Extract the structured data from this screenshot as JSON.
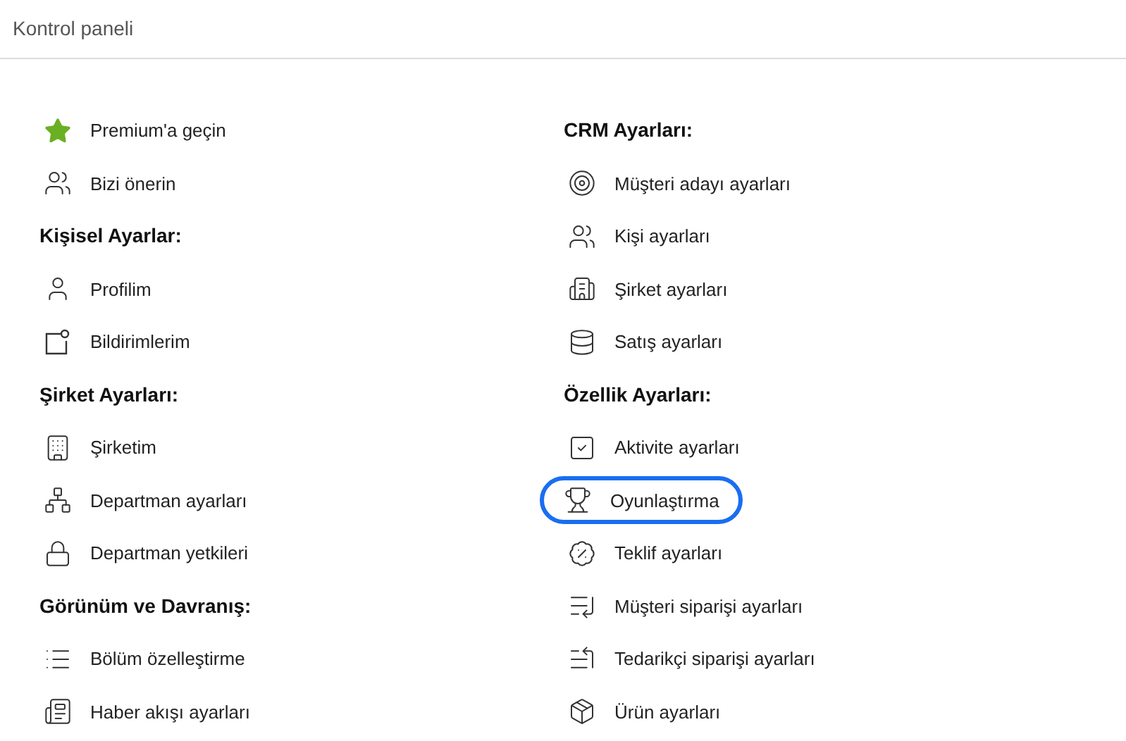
{
  "header": {
    "title": "Kontrol paneli"
  },
  "columns": [
    {
      "items": [
        {
          "kind": "link",
          "label": "Premium'a geçin",
          "highlighted": false
        },
        {
          "kind": "link",
          "label": "Bizi önerin",
          "highlighted": false
        },
        {
          "kind": "heading",
          "label": "Kişisel Ayarlar:"
        },
        {
          "kind": "link",
          "label": "Profilim",
          "highlighted": false
        },
        {
          "kind": "link",
          "label": "Bildirimlerim",
          "highlighted": false
        },
        {
          "kind": "heading",
          "label": "Şirket Ayarları:"
        },
        {
          "kind": "link",
          "label": "Şirketim",
          "highlighted": false
        },
        {
          "kind": "link",
          "label": "Departman ayarları",
          "highlighted": false
        },
        {
          "kind": "link",
          "label": "Departman yetkileri",
          "highlighted": false
        },
        {
          "kind": "heading",
          "label": "Görünüm ve Davranış:"
        },
        {
          "kind": "link",
          "label": "Bölüm özelleştirme",
          "highlighted": false
        },
        {
          "kind": "link",
          "label": "Haber akışı ayarları",
          "highlighted": false
        }
      ]
    },
    {
      "items": [
        {
          "kind": "heading",
          "label": "CRM Ayarları:"
        },
        {
          "kind": "link",
          "label": "Müşteri adayı ayarları",
          "highlighted": false
        },
        {
          "kind": "link",
          "label": "Kişi ayarları",
          "highlighted": false
        },
        {
          "kind": "link",
          "label": "Şirket ayarları",
          "highlighted": false
        },
        {
          "kind": "link",
          "label": "Satış ayarları",
          "highlighted": false
        },
        {
          "kind": "heading",
          "label": "Özellik Ayarları:"
        },
        {
          "kind": "link",
          "label": "Aktivite ayarları",
          "highlighted": false
        },
        {
          "kind": "link",
          "label": "Oyunlaştırma",
          "highlighted": true
        },
        {
          "kind": "link",
          "label": "Teklif ayarları",
          "highlighted": false
        },
        {
          "kind": "link",
          "label": "Müşteri siparişi ayarları",
          "highlighted": false
        },
        {
          "kind": "link",
          "label": "Tedarikçi siparişi ayarları",
          "highlighted": false
        },
        {
          "kind": "link",
          "label": "Ürün ayarları",
          "highlighted": false
        }
      ]
    }
  ]
}
